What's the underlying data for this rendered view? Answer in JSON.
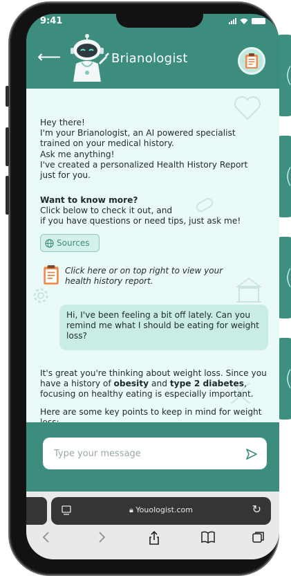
{
  "status": {
    "time": "9:41"
  },
  "header": {
    "title": "Brianologist"
  },
  "chat": {
    "intro": "Hey there!\nI'm your Brianologist, an AI powered specialist trained on your medical history.\nAsk me anything!\nI've created a personalized Health History Report just for you.",
    "more_heading": "Want to know more?",
    "more_body": "Click below to check it out, and\nif you have questions or need tips, just ask me!",
    "sources_label": "Sources",
    "report_link": "Click here or on top right to view your\nhealth history report.",
    "user_message": "Hi, I've been feeling a bit off lately. Can you remind me what I should be eating for weight loss?",
    "response_p1_a": "It's great you're thinking about weight loss. Since you have a history of ",
    "response_p1_b": "obesity",
    "response_p1_c": " and ",
    "response_p1_d": "type 2 diabetes",
    "response_p1_e": ", focusing on healthy eating is especially important.",
    "response_p2": "Here are some key points to keep in mind for weight loss:"
  },
  "input": {
    "placeholder": "Type your message"
  },
  "browser": {
    "url": "Youologist.com"
  },
  "colors": {
    "primary": "#3c8d7d",
    "chat_bg": "#eafaf8",
    "bubble": "#c9ece4"
  }
}
